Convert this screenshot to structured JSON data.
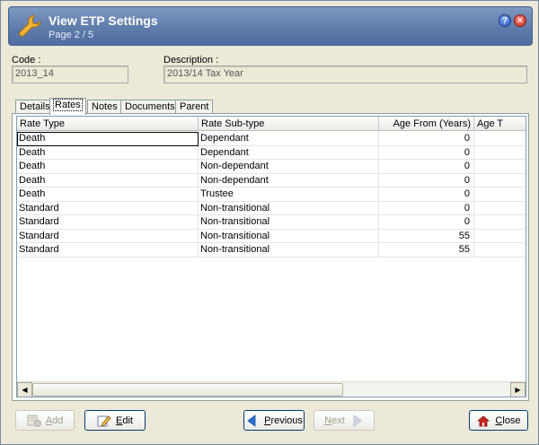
{
  "window": {
    "title": "View ETP Settings",
    "page_indicator": "Page 2 / 5",
    "help_glyph": "?",
    "close_glyph": "✕"
  },
  "fields": {
    "code": {
      "label": "Code :",
      "value": "2013_14"
    },
    "description": {
      "label": "Description :",
      "value": "2013/14 Tax Year"
    }
  },
  "tabs": [
    {
      "label": "Details"
    },
    {
      "label": "Rates",
      "active": true
    },
    {
      "label": "Notes"
    },
    {
      "label": "Documents"
    },
    {
      "label": "Parent"
    }
  ],
  "grid": {
    "columns": [
      "Rate Type",
      "Rate Sub-type",
      "Age From (Years)",
      "Age T"
    ],
    "rows": [
      [
        "Death",
        "Dependant",
        "0"
      ],
      [
        "Death",
        "Dependant",
        "0"
      ],
      [
        "Death",
        "Non-dependant",
        "0"
      ],
      [
        "Death",
        "Non-dependant",
        "0"
      ],
      [
        "Death",
        "Trustee",
        "0"
      ],
      [
        "Standard",
        "Non-transitional",
        "0"
      ],
      [
        "Standard",
        "Non-transitional",
        "0"
      ],
      [
        "Standard",
        "Non-transitional",
        "55"
      ],
      [
        "Standard",
        "Non-transitional",
        "55"
      ]
    ],
    "scroll_left_glyph": "◀",
    "scroll_right_glyph": "▶"
  },
  "buttons": {
    "add": {
      "first": "A",
      "rest": "dd",
      "enabled": false
    },
    "edit": {
      "first": "E",
      "rest": "dit",
      "enabled": true
    },
    "previous": {
      "first": "P",
      "rest": "revious",
      "enabled": true
    },
    "next": {
      "first": "N",
      "rest": "ext",
      "enabled": false
    },
    "close": {
      "first": "C",
      "rest": "lose",
      "enabled": true
    }
  },
  "icons": {
    "app": "wrench-icon",
    "add": "add-record-icon",
    "edit": "edit-pencil-icon",
    "previous": "arrow-left-icon",
    "next": "arrow-right-icon",
    "close": "exit-icon"
  },
  "colors": {
    "header_accent": "#5f7cab",
    "previous_arrow": "#2a6fd6",
    "close_icon": "#c8281c"
  }
}
